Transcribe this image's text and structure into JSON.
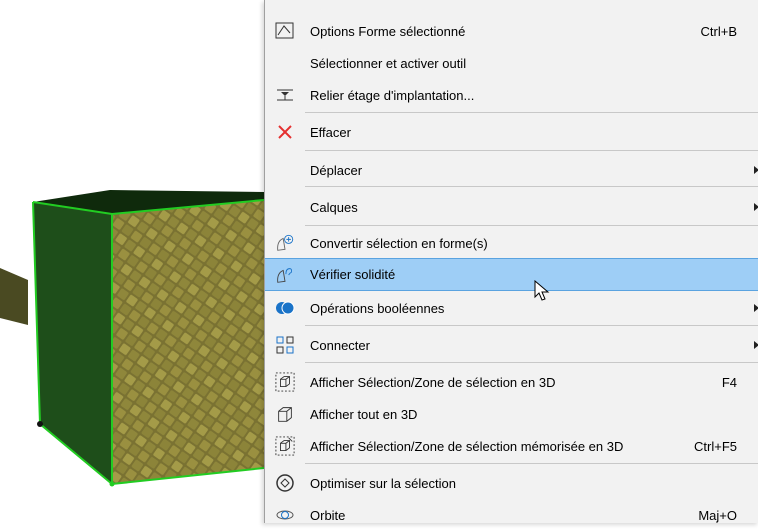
{
  "scene": {
    "object_fill": "#6b6a2a",
    "selection_color": "#22cc22"
  },
  "menu": {
    "items": [
      {
        "label": "Options Forme sélectionné",
        "shortcut": "Ctrl+B",
        "icon": "shape-options-icon"
      },
      {
        "label": "Sélectionner et activer outil",
        "shortcut": "",
        "icon": ""
      },
      {
        "label": "Relier étage d'implantation...",
        "shortcut": "",
        "icon": "link-story-icon"
      },
      {
        "label": "Effacer",
        "shortcut": "",
        "icon": "delete-x-icon"
      },
      {
        "label": "Déplacer",
        "shortcut": "",
        "icon": "",
        "submenu": true
      },
      {
        "label": "Calques",
        "shortcut": "",
        "icon": "",
        "submenu": true
      },
      {
        "label": "Convertir sélection en forme(s)",
        "shortcut": "",
        "icon": "convert-to-shape-icon"
      },
      {
        "label": "Vérifier solidité",
        "shortcut": "",
        "icon": "check-solidity-icon",
        "highlighted": true
      },
      {
        "label": "Opérations booléennes",
        "shortcut": "",
        "icon": "boolean-operations-icon",
        "submenu": true
      },
      {
        "label": "Connecter",
        "shortcut": "",
        "icon": "connect-icon",
        "submenu": true
      },
      {
        "label": "Afficher Sélection/Zone de sélection en 3D",
        "shortcut": "F4",
        "icon": "show-selection-3d-icon"
      },
      {
        "label": "Afficher tout en 3D",
        "shortcut": "",
        "icon": "show-all-3d-icon"
      },
      {
        "label": "Afficher Sélection/Zone de sélection mémorisée en 3D",
        "shortcut": "Ctrl+F5",
        "icon": "show-stored-selection-3d-icon"
      },
      {
        "label": "Optimiser sur la sélection",
        "shortcut": "",
        "icon": "fit-to-selection-icon"
      },
      {
        "label": "Orbite",
        "shortcut": "Maj+O",
        "icon": "orbit-icon"
      }
    ]
  }
}
